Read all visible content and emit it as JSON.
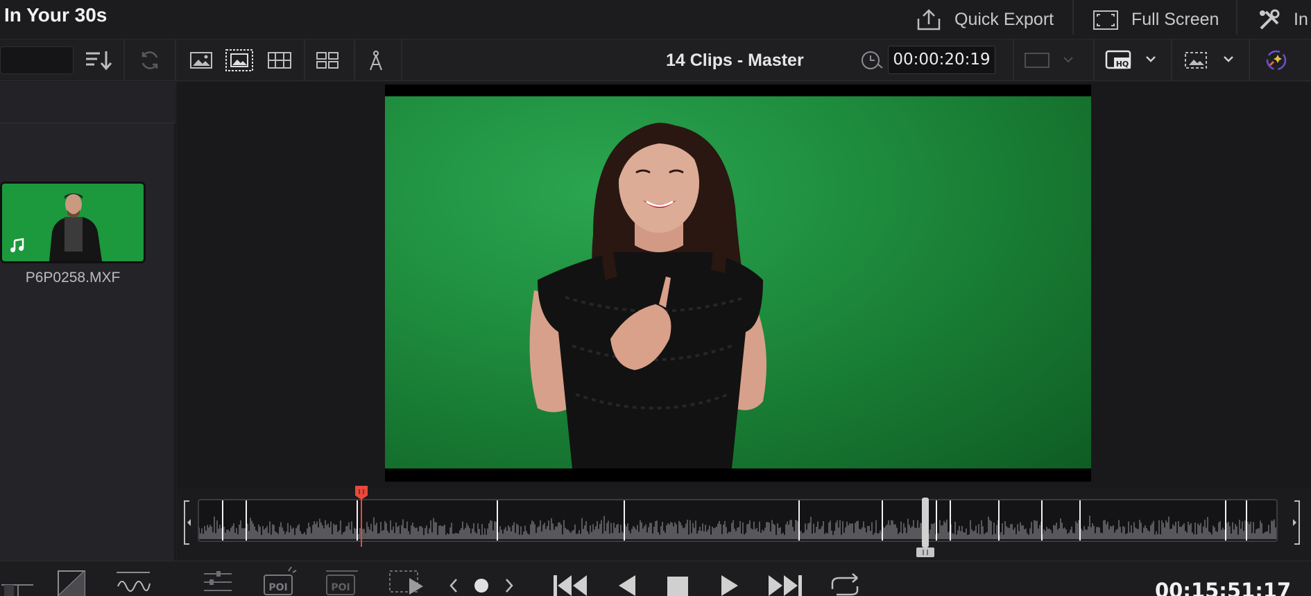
{
  "project": {
    "title": "In Your 30s"
  },
  "top_actions": {
    "quick_export": "Quick Export",
    "full_screen": "Full Screen",
    "inspector_partial": "In"
  },
  "toolbar": {
    "viewer_title": "14 Clips - Master",
    "timecode": "00:00:20:19"
  },
  "media_pool": {
    "clips": [
      {
        "name": "P6P0258.MXF",
        "has_audio": true
      }
    ]
  },
  "transport": {
    "timecode": "00:15:51:17",
    "poi_label_1": "POI",
    "poi_label_2": "POI"
  },
  "icons": {
    "quick_export": "upload-icon",
    "full_screen": "fullscreen-icon",
    "inspector": "tools-icon",
    "sort": "sort-icon",
    "sync": "sync-icon",
    "view_mode": "image-icon",
    "hq": "hq-icon"
  },
  "colors": {
    "background": "#1e1e21",
    "green_screen": "#1f8f3f",
    "playhead": "#e64a3c",
    "text": "#d6d6d6"
  }
}
